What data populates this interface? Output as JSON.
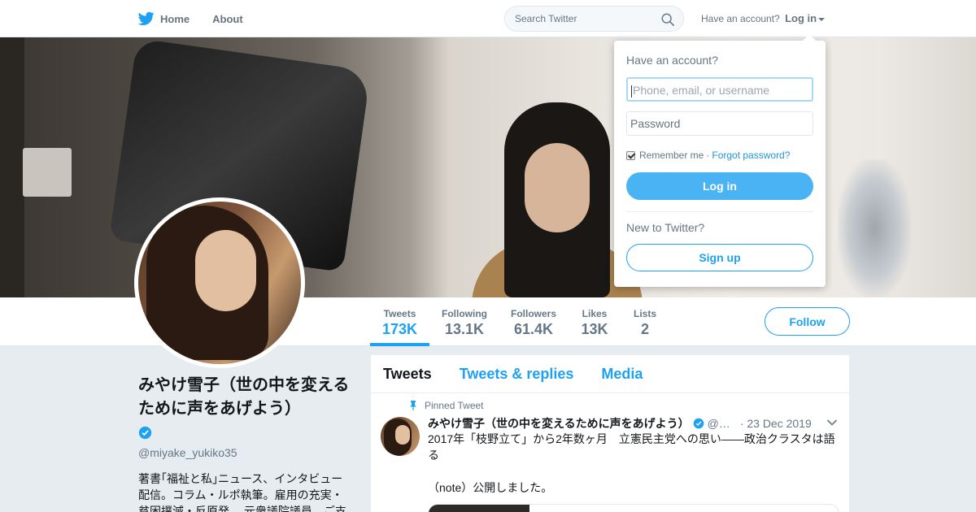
{
  "nav": {
    "home_label": "Home",
    "about_label": "About",
    "search_placeholder": "Search Twitter",
    "have_account": "Have an account?",
    "login_label": "Log in"
  },
  "profile_nav": {
    "stats": [
      {
        "label": "Tweets",
        "value": "173K",
        "active": true
      },
      {
        "label": "Following",
        "value": "13.1K"
      },
      {
        "label": "Followers",
        "value": "61.4K"
      },
      {
        "label": "Likes",
        "value": "13K"
      },
      {
        "label": "Lists",
        "value": "2"
      }
    ],
    "follow_label": "Follow"
  },
  "profile": {
    "name": "みやけ雪子（世の中を変えるために声をあげよう）",
    "handle": "@miyake_yukiko35",
    "bio": "著書｢福祉と私｣ニュース、インタビュー配信。コラム・ルポ執筆。雇用の充実・貧困撲滅・反原発。 元衆議院議員　ご支"
  },
  "timeline": {
    "tabs": [
      "Tweets",
      "Tweets & replies",
      "Media"
    ],
    "pinned_label": "Pinned Tweet",
    "tweet": {
      "name": "みやけ雪子（世の中を変えるために声をあげよう）",
      "handle": "@…",
      "date": "· 23 Dec 2019",
      "line1": "2017年「枝野立て」から2年数ヶ月　立憲民主党への思い――政治クラスタは語る",
      "line2": "（note）公開しました。"
    }
  },
  "login_dropdown": {
    "title": "Have an account?",
    "username_placeholder": "Phone, email, or username",
    "password_placeholder": "Password",
    "remember_label": "Remember me",
    "separator": "·",
    "forgot_label": "Forgot password?",
    "login_button": "Log in",
    "new_label": "New to Twitter?",
    "signup_button": "Sign up"
  },
  "colors": {
    "accent": "#1da1f2",
    "login_button_bg": "#4ab3f4",
    "background": "#e6ecf0"
  },
  "icons": [
    "twitter-bird-icon",
    "search-icon",
    "caret-down-icon",
    "verified-badge-icon",
    "pin-icon",
    "chevron-down-icon"
  ]
}
